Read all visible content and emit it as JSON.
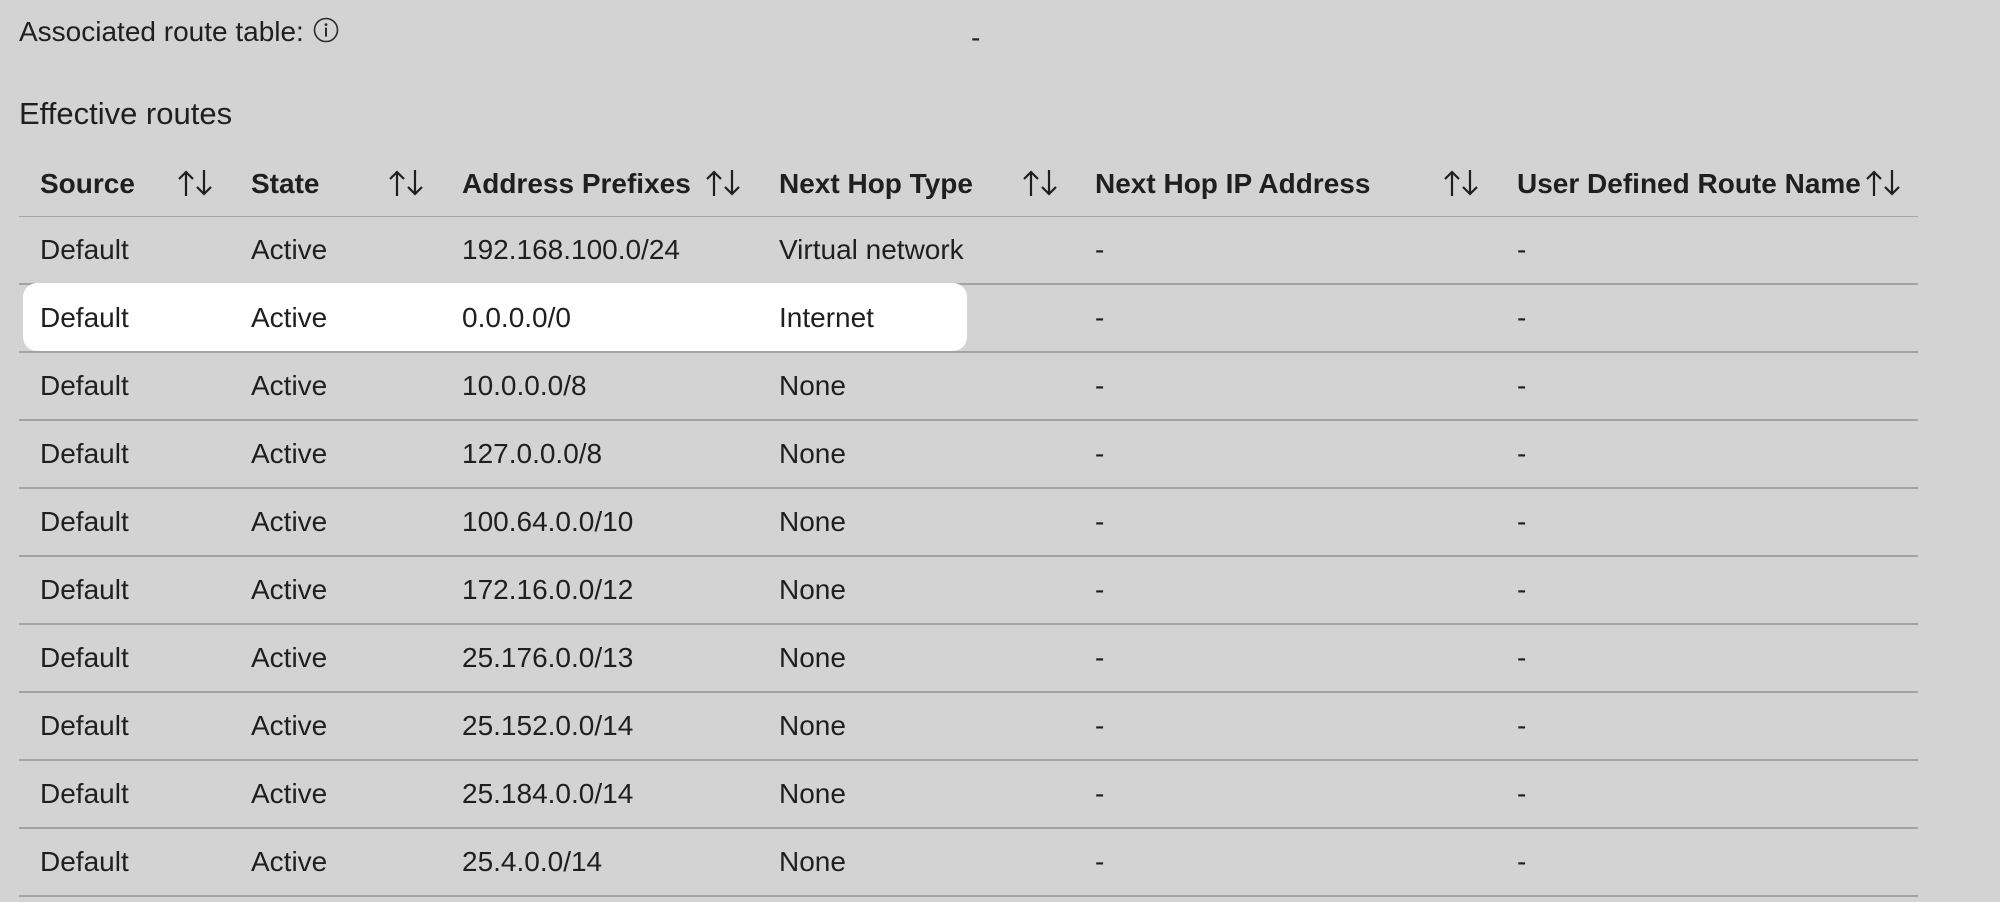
{
  "associated_route_table": {
    "label": "Associated route table:",
    "info_icon": "info-icon",
    "value": "-"
  },
  "effective_routes": {
    "title": "Effective routes",
    "sort_icon": "sort-updown-icon",
    "columns": [
      "Source",
      "State",
      "Address Prefixes",
      "Next Hop Type",
      "Next Hop IP Address",
      "User Defined Route Name"
    ],
    "highlighted_row_index": 1,
    "rows": [
      [
        "Default",
        "Active",
        "192.168.100.0/24",
        "Virtual network",
        "-",
        "-"
      ],
      [
        "Default",
        "Active",
        "0.0.0.0/0",
        "Internet",
        "-",
        "-"
      ],
      [
        "Default",
        "Active",
        "10.0.0.0/8",
        "None",
        "-",
        "-"
      ],
      [
        "Default",
        "Active",
        "127.0.0.0/8",
        "None",
        "-",
        "-"
      ],
      [
        "Default",
        "Active",
        "100.64.0.0/10",
        "None",
        "-",
        "-"
      ],
      [
        "Default",
        "Active",
        "172.16.0.0/12",
        "None",
        "-",
        "-"
      ],
      [
        "Default",
        "Active",
        "25.176.0.0/13",
        "None",
        "-",
        "-"
      ],
      [
        "Default",
        "Active",
        "25.152.0.0/14",
        "None",
        "-",
        "-"
      ],
      [
        "Default",
        "Active",
        "25.184.0.0/14",
        "None",
        "-",
        "-"
      ],
      [
        "Default",
        "Active",
        "25.4.0.0/14",
        "None",
        "-",
        "-"
      ]
    ]
  }
}
